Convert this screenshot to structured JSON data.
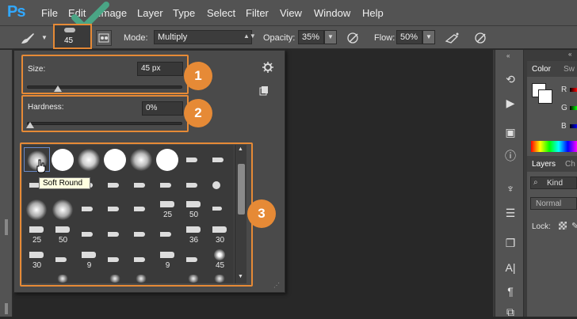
{
  "app": {
    "logo": "Ps"
  },
  "menu": {
    "items": [
      "File",
      "Edit",
      "Image",
      "Layer",
      "Type",
      "Select",
      "Filter",
      "View",
      "Window",
      "Help"
    ]
  },
  "options": {
    "brush_size_value": "45",
    "mode_label": "Mode:",
    "mode_value": "Multiply",
    "opacity_label": "Opacity:",
    "opacity_value": "35%",
    "flow_label": "Flow:",
    "flow_value": "50%"
  },
  "brush_panel": {
    "size_label": "Size:",
    "size_value": "45 px",
    "hardness_label": "Hardness:",
    "hardness_value": "0%",
    "size_level_fraction": 0.2,
    "hardness_level_fraction": 0.0,
    "callouts": [
      "1",
      "2",
      "3"
    ],
    "tooltip": "Soft Round",
    "preset_labels": [
      "25",
      "50",
      "25",
      "50",
      "36",
      "30",
      "30",
      "9",
      "9",
      "45"
    ]
  },
  "right_panel": {
    "tab_color": "Color",
    "tab_swatches_abbrev": "Sw",
    "color_channels": [
      "R",
      "G",
      "B"
    ],
    "tab_layers": "Layers",
    "tab_channels_abbrev": "Ch",
    "kind_placeholder": "Kind",
    "blend_mode": "Normal",
    "lock_label": "Lock:"
  },
  "colors": {
    "accent_orange": "#e68a36",
    "ps_blue": "#31a8ff",
    "checkmark_green": "#4aa585"
  },
  "icons": [
    "brush-icon",
    "checkmark-icon",
    "gear-icon",
    "airbrush-icon",
    "history-icon",
    "play-icon",
    "info-icon",
    "text-icon",
    "paragraph-icon"
  ]
}
